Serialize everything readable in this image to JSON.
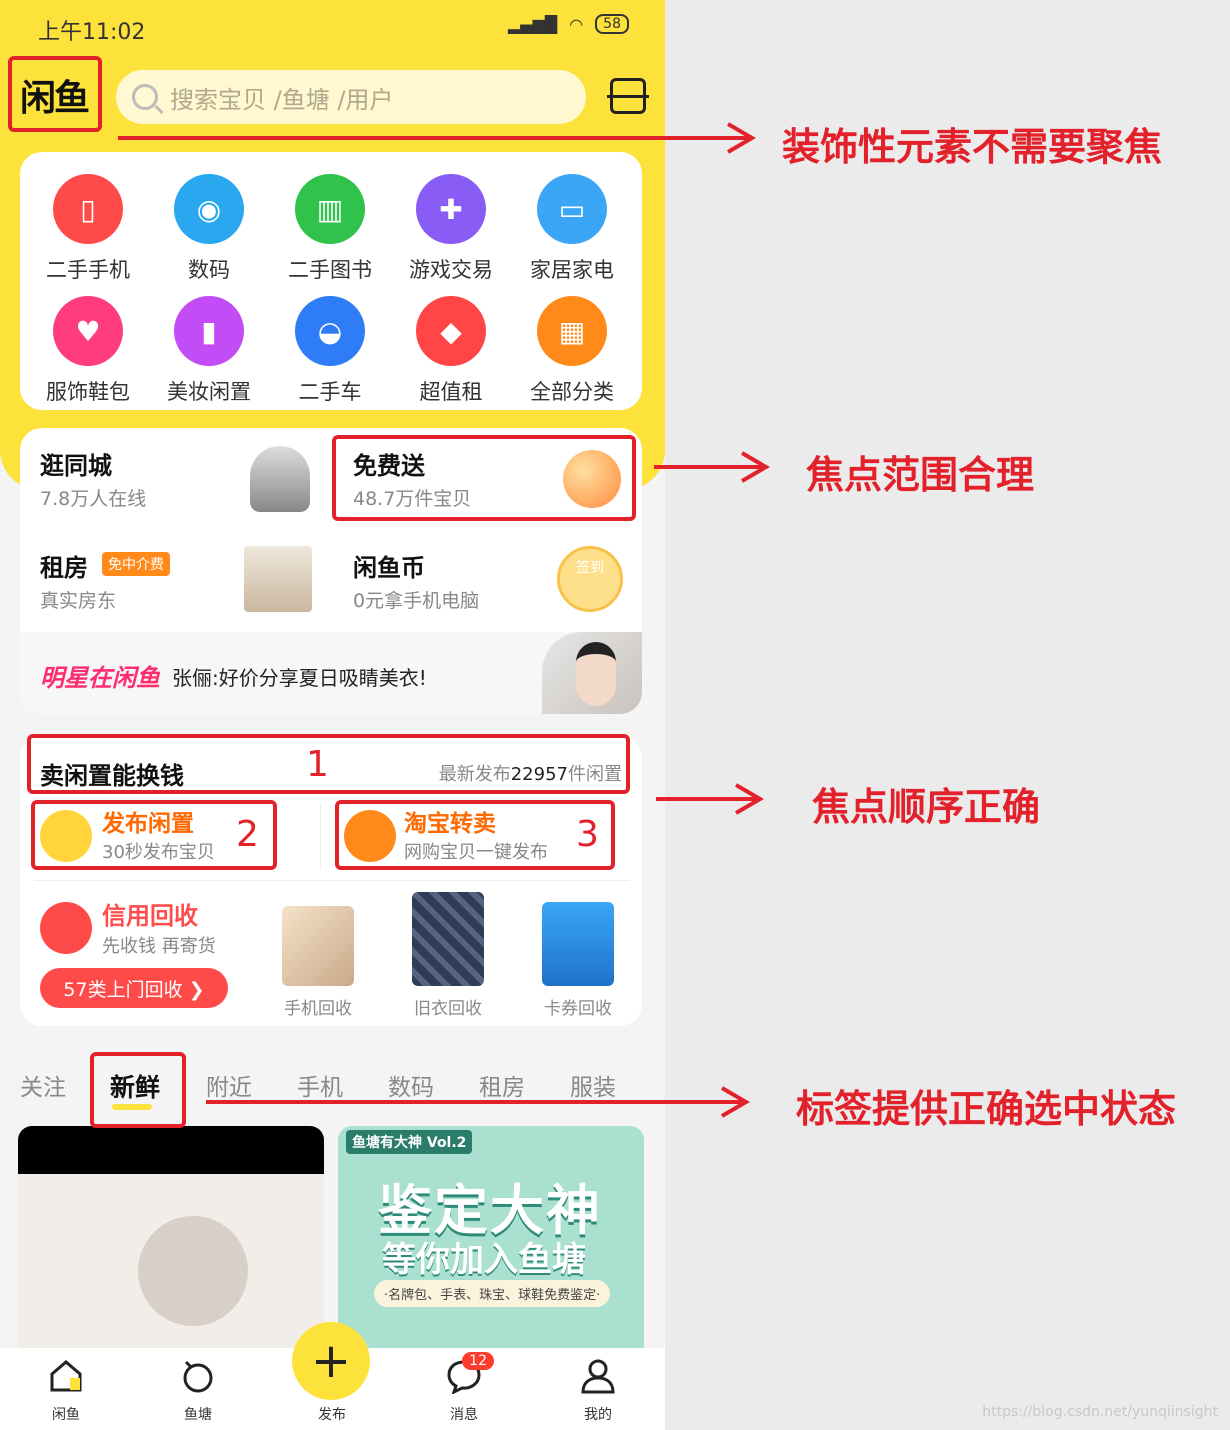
{
  "status_bar": {
    "time": "上午11:02",
    "battery": "58"
  },
  "header": {
    "logo": "闲鱼",
    "search_placeholder": "搜索宝贝 /鱼塘 /用户"
  },
  "categories": [
    {
      "label": "二手手机",
      "color": "#ff4a4a"
    },
    {
      "label": "数码",
      "color": "#29a8f0"
    },
    {
      "label": "二手图书",
      "color": "#2fc34c"
    },
    {
      "label": "游戏交易",
      "color": "#8a5cf6"
    },
    {
      "label": "家居家电",
      "color": "#3aa6f5"
    },
    {
      "label": "服饰鞋包",
      "color": "#ff3c7e"
    },
    {
      "label": "美妆闲置",
      "color": "#c24cf6"
    },
    {
      "label": "二手车",
      "color": "#2e7cf6"
    },
    {
      "label": "超值租",
      "color": "#ff4545"
    },
    {
      "label": "全部分类",
      "color": "#ff8a1a"
    }
  ],
  "tiles": {
    "city": {
      "title": "逛同城",
      "sub": "7.8万人在线"
    },
    "free": {
      "title": "免费送",
      "sub": "48.7万件宝贝"
    },
    "rent": {
      "title": "租房",
      "badge": "免中介费",
      "sub": "真实房东"
    },
    "coin": {
      "title": "闲鱼币",
      "sub": "0元拿手机电脑",
      "stamp": "签到"
    }
  },
  "star_row": {
    "logo": "明星在闲鱼",
    "text": "张俪:好价分享夏日吸睛美衣!"
  },
  "sell": {
    "title": "卖闲置能换钱",
    "meta_prefix": "最新发布",
    "meta_count": "22957",
    "meta_suffix": "件闲置",
    "publish_title": "发布闲置",
    "publish_sub": "30秒发布宝贝",
    "taobao_title": "淘宝转卖",
    "taobao_sub": "网购宝贝一键发布",
    "recycle_title": "信用回收",
    "recycle_sub": "先收钱 再寄货",
    "recycle_btn": "57类上门回收 ❯",
    "rec_items": [
      "手机回收",
      "旧衣回收",
      "卡券回收"
    ]
  },
  "tabs": [
    "关注",
    "新鲜",
    "附近",
    "手机",
    "数码",
    "租房",
    "服装"
  ],
  "feed_right": {
    "tag": "鱼塘有大神 Vol.2",
    "head": "鉴定大神",
    "head2": "等你加入鱼塘",
    "pill": "·名牌包、手表、珠宝、球鞋免费鉴定·"
  },
  "bottom_nav": {
    "home": "闲鱼",
    "pond": "鱼塘",
    "publish": "发布",
    "msg": "消息",
    "msg_badge": "12",
    "me": "我的"
  },
  "annotations": {
    "a1": "装饰性元素不需要聚焦",
    "a2": "焦点范围合理",
    "a3": "焦点顺序正确",
    "a4": "标签提供正确选中状态",
    "n1": "1",
    "n2": "2",
    "n3": "3"
  },
  "watermark": "https://blog.csdn.net/yunqiinsight",
  "colors": {
    "yellow": "#fde23b",
    "annotation_red": "#e3212b"
  }
}
